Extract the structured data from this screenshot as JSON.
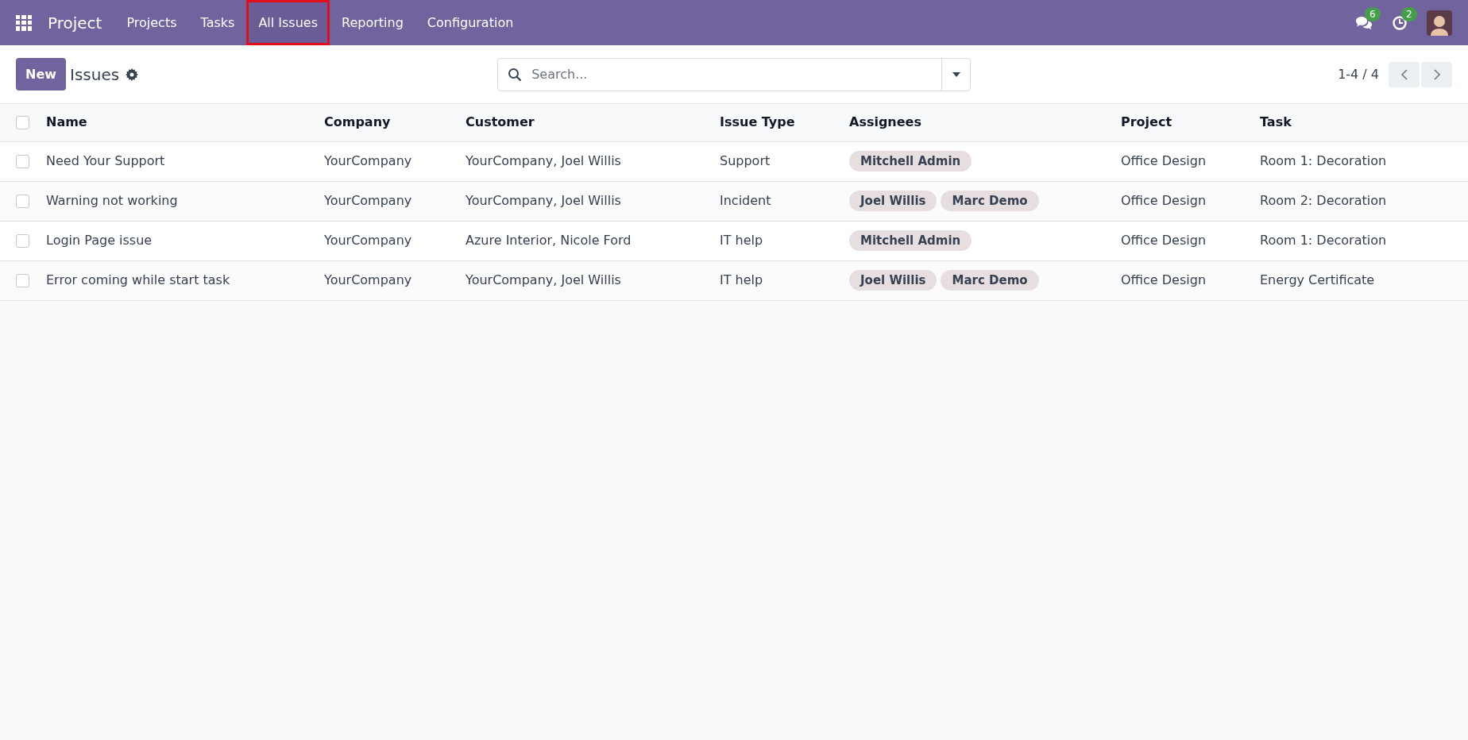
{
  "navbar": {
    "app_name": "Project",
    "menu": [
      {
        "label": "Projects",
        "highlighted": false
      },
      {
        "label": "Tasks",
        "highlighted": false
      },
      {
        "label": "All Issues",
        "highlighted": true
      },
      {
        "label": "Reporting",
        "highlighted": false
      },
      {
        "label": "Configuration",
        "highlighted": false
      }
    ],
    "messages_badge": "6",
    "activities_badge": "2"
  },
  "control_panel": {
    "new_button": "New",
    "title": "Issues",
    "search": {
      "placeholder": "Search..."
    },
    "pager": "1-4 / 4"
  },
  "table": {
    "select_all_checked": false,
    "columns": [
      "Name",
      "Company",
      "Customer",
      "Issue Type",
      "Assignees",
      "Project",
      "Task"
    ],
    "rows": [
      {
        "checked": false,
        "name": "Need Your Support",
        "company": "YourCompany",
        "customer": "YourCompany, Joel Willis",
        "issue_type": "Support",
        "assignees": [
          "Mitchell Admin"
        ],
        "project": "Office Design",
        "task": "Room 1: Decoration"
      },
      {
        "checked": false,
        "name": "Warning not working",
        "company": "YourCompany",
        "customer": "YourCompany, Joel Willis",
        "issue_type": "Incident",
        "assignees": [
          "Joel Willis",
          "Marc Demo"
        ],
        "project": "Office Design",
        "task": "Room 2: Decoration"
      },
      {
        "checked": false,
        "name": "Login Page issue",
        "company": "YourCompany",
        "customer": "Azure Interior, Nicole Ford",
        "issue_type": "IT help",
        "assignees": [
          "Mitchell Admin"
        ],
        "project": "Office Design",
        "task": "Room 1: Decoration"
      },
      {
        "checked": false,
        "name": "Error coming while start task",
        "company": "YourCompany",
        "customer": "YourCompany, Joel Willis",
        "issue_type": "IT help",
        "assignees": [
          "Joel Willis",
          "Marc Demo"
        ],
        "project": "Office Design",
        "task": "Energy Certificate"
      }
    ]
  }
}
